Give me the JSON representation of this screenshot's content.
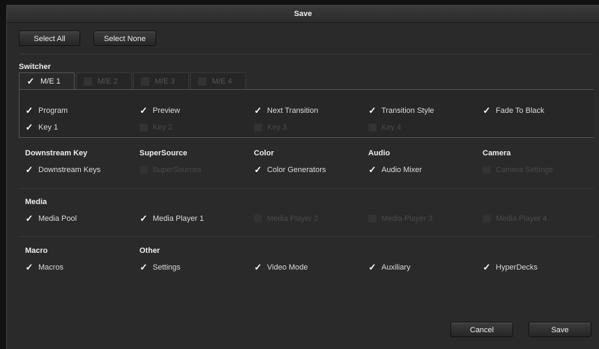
{
  "window": {
    "title": "Save"
  },
  "top_buttons": {
    "select_all": "Select All",
    "select_none": "Select None"
  },
  "switcher": {
    "title": "Switcher",
    "tabs": [
      {
        "label": "M/E 1",
        "checked": true
      },
      {
        "label": "M/E 2",
        "checked": false
      },
      {
        "label": "M/E 3",
        "checked": false
      },
      {
        "label": "M/E 4",
        "checked": false
      }
    ],
    "row1": [
      {
        "label": "Program",
        "checked": true
      },
      {
        "label": "Preview",
        "checked": true
      },
      {
        "label": "Next Transition",
        "checked": true
      },
      {
        "label": "Transition Style",
        "checked": true
      },
      {
        "label": "Fade To Black",
        "checked": true
      }
    ],
    "row2": [
      {
        "label": "Key 1",
        "checked": true
      },
      {
        "label": "Key 2",
        "checked": false
      },
      {
        "label": "Key 3",
        "checked": false
      },
      {
        "label": "Key 4",
        "checked": false
      }
    ]
  },
  "groups": {
    "downstream": {
      "title": "Downstream Key",
      "label": "Downstream Keys",
      "checked": true
    },
    "supersource": {
      "title": "SuperSource",
      "label": "SuperSources",
      "checked": false
    },
    "color": {
      "title": "Color",
      "label": "Color Generators",
      "checked": true
    },
    "audio": {
      "title": "Audio",
      "label": "Audio Mixer",
      "checked": true
    },
    "camera": {
      "title": "Camera",
      "label": "Camera Settings",
      "checked": false
    }
  },
  "media": {
    "title": "Media",
    "items": [
      {
        "label": "Media Pool",
        "checked": true
      },
      {
        "label": "Media Player 1",
        "checked": true
      },
      {
        "label": "Media Player 2",
        "checked": false
      },
      {
        "label": "Media Player 3",
        "checked": false
      },
      {
        "label": "Media Player 4",
        "checked": false
      }
    ]
  },
  "macro": {
    "title": "Macro",
    "label": "Macros",
    "checked": true
  },
  "other": {
    "title": "Other",
    "items": [
      {
        "label": "Settings",
        "checked": true
      },
      {
        "label": "Video Mode",
        "checked": true
      },
      {
        "label": "Auxiliary",
        "checked": true
      },
      {
        "label": "HyperDecks",
        "checked": true
      }
    ]
  },
  "footer": {
    "cancel": "Cancel",
    "save": "Save"
  },
  "check_glyph": "✓"
}
